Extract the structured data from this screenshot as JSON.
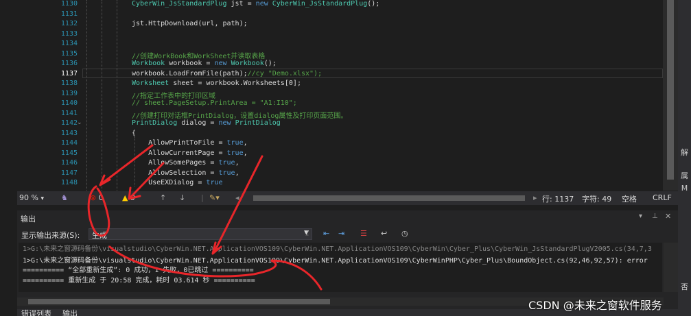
{
  "editor": {
    "line_numbers": [
      "1130",
      "1131",
      "1132",
      "1133",
      "1134",
      "1135",
      "1136",
      "1137",
      "1138",
      "1139",
      "1140",
      "1141",
      "1142",
      "1143",
      "1144",
      "1145",
      "1146",
      "1147",
      "1148"
    ],
    "current_line_number": "1137",
    "lines": [
      "CyberWin_JsStandardPlug jst = new CyberWin_JsStandardPlug();",
      "",
      "jst.HttpDownload(url, path);",
      "",
      "",
      "//创建WorkBook和WorkSheet并读取表格",
      "Workbook workbook = new Workbook();",
      "workbook.LoadFromFile(path);//cy \"Demo.xlsx\");",
      "Worksheet sheet = workbook.Worksheets[0];",
      "//指定工作表中的打印区域",
      "// sheet.PageSetup.PrintArea = \"A1:I10\";",
      "//创建打印对话框PrintDialog，设置dialog属性及打印页面范围。",
      "PrintDialog dialog = new PrintDialog",
      "{",
      "    AllowPrintToFile = true,",
      "    AllowCurrentPage = true,",
      "    AllowSomePages = true,",
      "    AllowSelection = true,",
      "    UseEXDialog = true"
    ]
  },
  "status_bar": {
    "zoom": "90 %",
    "errors": "0",
    "warnings": "9",
    "line": "行: 1137",
    "col": "字符: 49",
    "space": "空格",
    "eol": "CRLF"
  },
  "output": {
    "title": "输出",
    "source_label": "显示输出来源(S):",
    "source_value": "生成",
    "lines": [
      "1>G:\\未来之窗源码备份\\visualstudio\\CyberWin.NET.ApplicationVOS109\\CyberWin.NET.ApplicationVOS109\\CyberWin\\Cyber_Plus\\CyberWin_JsStandardPlugV2005.cs(34,7,3",
      "1>G:\\未来之窗源码备份\\visualstudio\\CyberWin.NET.ApplicationVOS109\\CyberWin.NET.ApplicationVOS109\\CyberWinPHP\\Cyber_Plus\\BoundObject.cs(92,46,92,57): error",
      "========== “全部重新生成”: 0 成功，1 失败，0已跳过 ==========",
      "========== 重新生成 于 20:58 完成，耗时 03.614 秒 =========="
    ]
  },
  "bottom_tabs": [
    "错误列表",
    "输出"
  ],
  "right_panel": [
    "解",
    "属",
    "M",
    "否"
  ],
  "watermark": "CSDN @未来之窗软件服务",
  "colors": {
    "annotation": "#e8262a",
    "keyword": "#569cd6",
    "type": "#4ec9b0",
    "comment": "#57a64a",
    "string": "#d69d85"
  }
}
